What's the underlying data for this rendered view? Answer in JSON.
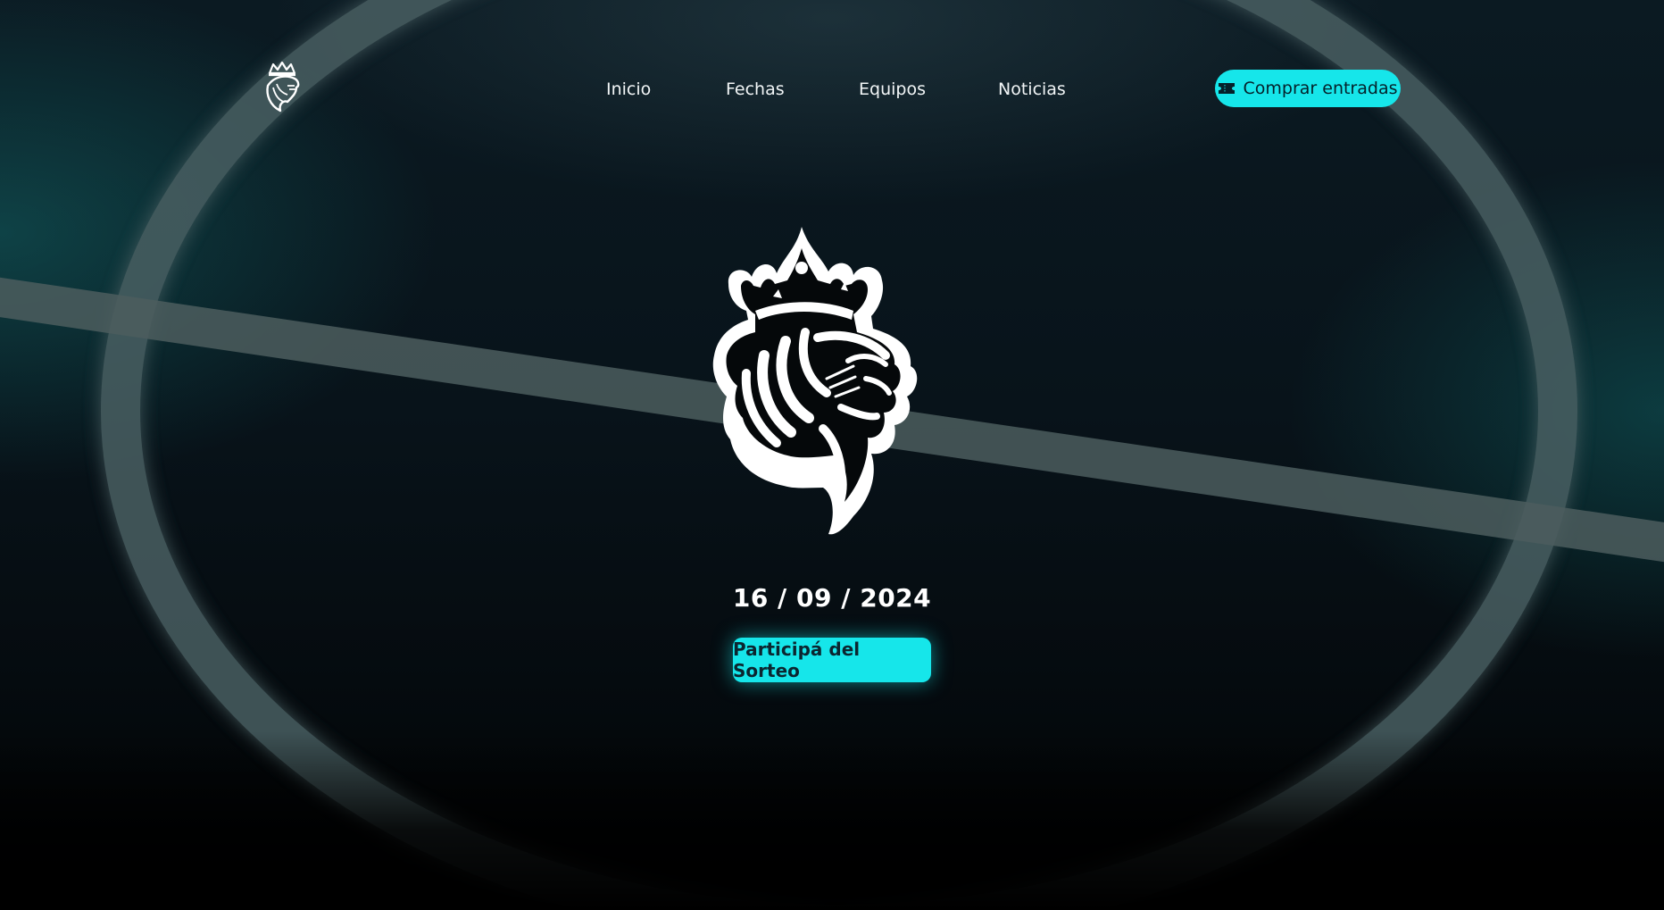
{
  "header": {
    "logo_icon": "crowned-lion-icon",
    "nav": [
      {
        "label": "Inicio"
      },
      {
        "label": "Fechas"
      },
      {
        "label": "Equipos"
      },
      {
        "label": "Noticias"
      }
    ],
    "buy_button": {
      "icon": "ticket-icon",
      "label": "Comprar entradas"
    }
  },
  "hero": {
    "crest_icon": "crowned-lion-icon",
    "date": "16 / 09 / 2024",
    "cta_label": "Participá del Sorteo"
  },
  "colors": {
    "accent": "#16e6ea",
    "background": "#050b0f",
    "text": "#ffffff"
  }
}
